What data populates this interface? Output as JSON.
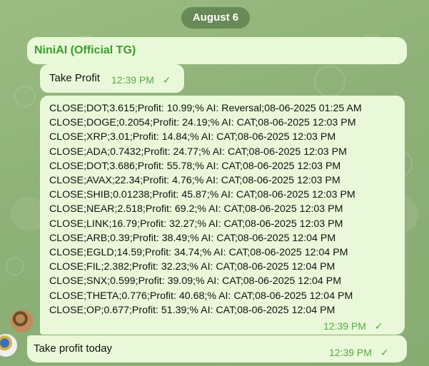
{
  "date_label": "August 6",
  "sender_name": "NiniAI (Official TG)",
  "messages": [
    {
      "text": "Take Profit",
      "time": "12:39 PM",
      "status": "✓"
    },
    {
      "lines": [
        "CLOSE;DOT;3.615;Profit: 10.99;% AI: Reversal;08-06-2025 01:25 AM",
        "CLOSE;DOGE;0.2054;Profit: 24.19;% AI: CAT;08-06-2025 12:03 PM",
        "CLOSE;XRP;3.01;Profit: 14.84;% AI: CAT;08-06-2025 12:03 PM",
        "CLOSE;ADA;0.7432;Profit: 24.77;% AI: CAT;08-06-2025 12:03 PM",
        "CLOSE;DOT;3.686;Profit: 55.78;% AI: CAT;08-06-2025 12:03 PM",
        "CLOSE;AVAX;22.34;Profit: 4.76;% AI: CAT;08-06-2025 12:03 PM",
        "CLOSE;SHIB;0.01238;Profit: 45.87;% AI: CAT;08-06-2025 12:03 PM",
        "CLOSE;NEAR;2.518;Profit: 69.2;% AI: CAT;08-06-2025 12:03 PM",
        "CLOSE;LINK;16.79;Profit: 32.27;% AI: CAT;08-06-2025 12:03 PM",
        "CLOSE;ARB;0.39;Profit: 38.49;% AI: CAT;08-06-2025 12:04 PM",
        "CLOSE;EGLD;14.59;Profit: 34.74;% AI: CAT;08-06-2025 12:04 PM",
        "CLOSE;FIL;2.382;Profit: 32.23;% AI: CAT;08-06-2025 12:04 PM",
        "CLOSE;SNX;0.599;Profit: 39.09;% AI: CAT;08-06-2025 12:04 PM",
        "CLOSE;THETA;0.776;Profit: 40.68;% AI: CAT;08-06-2025 12:04 PM",
        "CLOSE;OP;0.677;Profit: 51.39;% AI: CAT;08-06-2025 12:04 PM"
      ],
      "time": "12:39 PM",
      "status": "✓"
    },
    {
      "text": "Take profit today",
      "time": "12:39 PM",
      "status": "✓"
    }
  ],
  "colors": {
    "bubble": "#e9f8d8",
    "sender_name": "#3d9e2e",
    "meta": "#5aa84a",
    "date_pill": "#567848"
  },
  "icons": {
    "status": "single-check-icon",
    "avatar": "profile-avatar-icon"
  }
}
